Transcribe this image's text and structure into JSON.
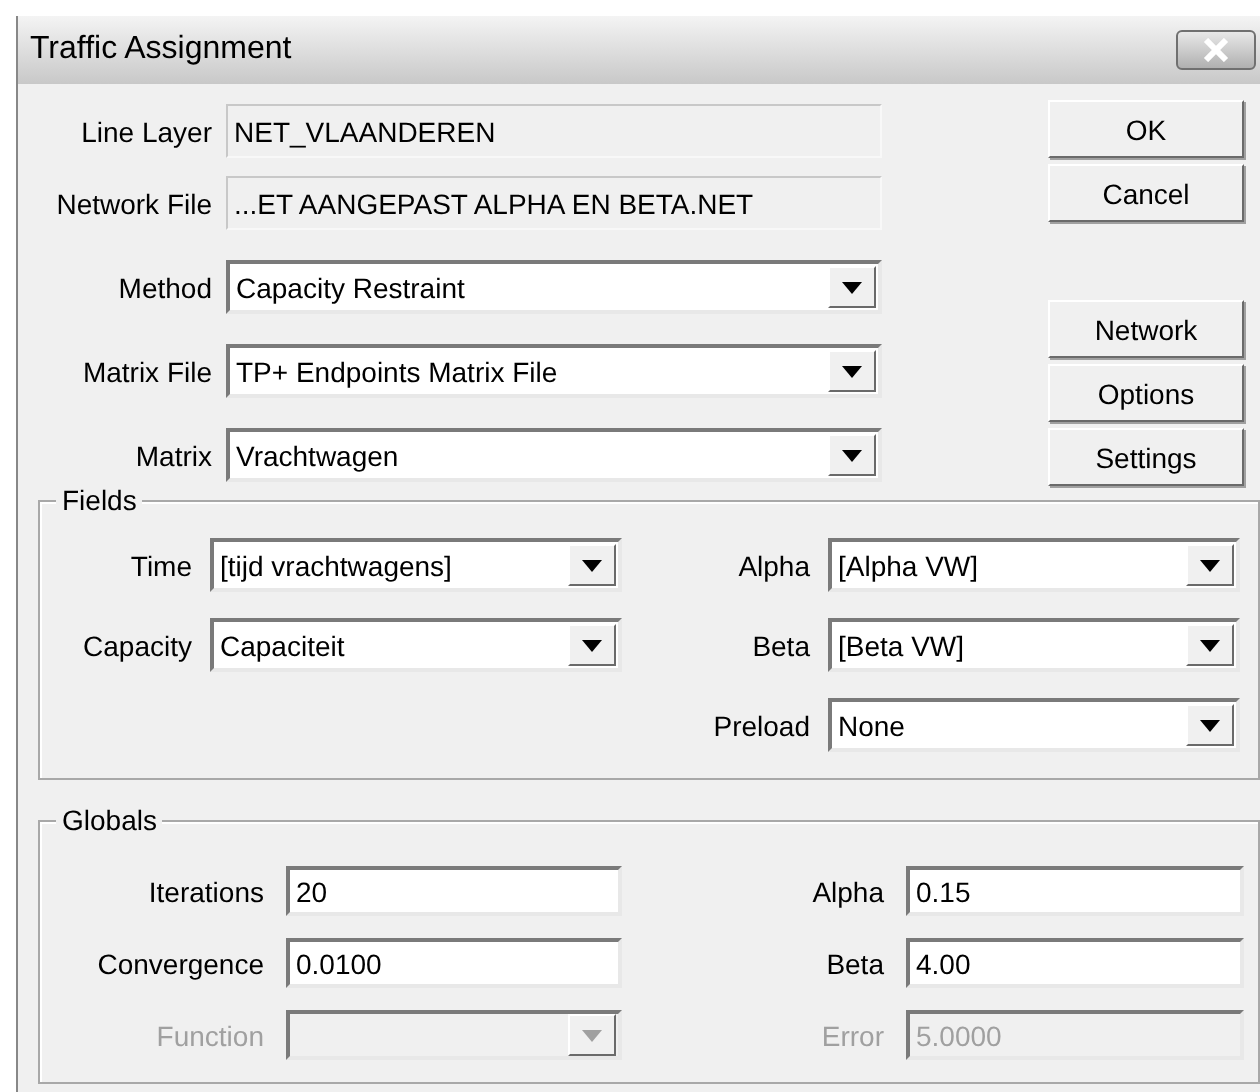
{
  "window": {
    "title": "Traffic Assignment"
  },
  "top_fields": [
    {
      "label": "Line Layer",
      "kind": "readonly",
      "value": "NET_VLAANDEREN"
    },
    {
      "label": "Network File",
      "kind": "readonly",
      "value": "...ET AANGEPAST ALPHA EN BETA.NET"
    },
    {
      "label": "Method",
      "kind": "dropdown",
      "value": "Capacity Restraint"
    },
    {
      "label": "Matrix File",
      "kind": "dropdown",
      "value": "TP+ Endpoints Matrix File"
    },
    {
      "label": "Matrix",
      "kind": "dropdown",
      "value": "Vrachtwagen"
    }
  ],
  "buttons": [
    "OK",
    "Cancel"
  ],
  "side_buttons": [
    "Network",
    "Options",
    "Settings"
  ],
  "fields_group": {
    "title": "Fields",
    "left": [
      {
        "label": "Time",
        "kind": "dropdown",
        "value": "[tijd vrachtwagens]"
      },
      {
        "label": "Capacity",
        "kind": "dropdown",
        "value": "Capaciteit"
      }
    ],
    "right": [
      {
        "label": "Alpha",
        "kind": "dropdown",
        "value": "[Alpha VW]"
      },
      {
        "label": "Beta",
        "kind": "dropdown",
        "value": "[Beta VW]"
      },
      {
        "label": "Preload",
        "kind": "dropdown",
        "value": "None"
      }
    ]
  },
  "globals": {
    "title": "Globals",
    "left": [
      {
        "label": "Iterations",
        "kind": "edit",
        "value": "20",
        "disabled": false
      },
      {
        "label": "Convergence",
        "kind": "edit",
        "value": "0.0100",
        "disabled": false
      },
      {
        "label": "Function",
        "kind": "dropdown",
        "disabled": true
      }
    ],
    "right": [
      {
        "label": "Alpha",
        "kind": "edit",
        "value": "0.15",
        "disabled": false
      },
      {
        "label": "Beta",
        "kind": "edit",
        "value": "4.00",
        "disabled": false
      },
      {
        "label": "Error",
        "kind": "edit",
        "value": "5.0000",
        "disabled": true
      }
    ]
  }
}
